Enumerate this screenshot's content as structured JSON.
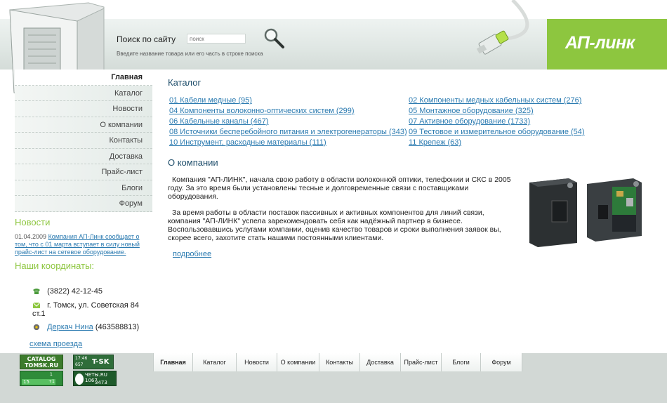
{
  "header": {
    "brand": "АП-линк",
    "search_title": "Поиск по сайту",
    "search_placeholder": "поиск",
    "search_hint": "Введите название товара или его часть в строке поиска"
  },
  "sidebar": {
    "items": [
      {
        "label": "Главная",
        "active": true
      },
      {
        "label": "Каталог"
      },
      {
        "label": "Новости"
      },
      {
        "label": "О компании"
      },
      {
        "label": "Контакты"
      },
      {
        "label": "Доставка"
      },
      {
        "label": "Прайс-лист"
      },
      {
        "label": "Блоги"
      },
      {
        "label": "Форум"
      }
    ],
    "news_title": "Новости",
    "news_date": "01.04.2009",
    "news_text": "Компания АП-Линк сообщает о том, что с 01 марта вступает в силу новый прайс-лист на сетевое оборудование.",
    "coords_title": "Наши координаты:",
    "phone": "(3822) 42-12-45",
    "address": "г. Томск, ул. Советская 84 ст.1",
    "icq_name": "Деркач Нина",
    "icq_number": "(463588813)",
    "scheme_link": "схема проезда"
  },
  "main": {
    "catalog_title": "Каталог",
    "catalog_left": [
      "01 Кабели медные (95)",
      "04 Компоненты волоконно-оптических систем (299)",
      "06 Кабельные каналы (467)",
      "08 Источники бесперебойного питания и электрогенераторы (343)",
      "10 Инструмент, расходные материалы (111)"
    ],
    "catalog_right": [
      "02 Компоненты медных кабельных систем (276)",
      "05 Монтажное оборудование (325)",
      "07 Активное оборудование (1733)",
      "09 Тестовое и измерительное оборудование (54)",
      "11 Крепеж (63)"
    ],
    "company_title": "О компании",
    "para1": "Компания \"АП-ЛИНК\", начала свою работу в области волоконной оптики, телефонии и СКС в 2005 году. За это время были установлены тесные и долговременные связи с поставщиками оборудования.",
    "para2": "За время работы в области поставок пассивных и активных компонентов для линий связи, компания \"АП-ЛИНК\" успела зарекомендовать себя как надёжный партнер в бизнесе. Воспользовавшись услугами компании, оценив качество товаров и сроки выполнения заявок вы, скорее всего, захотите стать нашими постоянными клиентами.",
    "more_link": "подробнее"
  },
  "footer": {
    "items": [
      "Главная",
      "Каталог",
      "Новости",
      "О компании",
      "Контакты",
      "Доставка",
      "Прайс-лист",
      "Блоги",
      "Форум"
    ],
    "badge_catalog_line1": "CATALOG",
    "badge_catalog_line2": "TOMSK.RU",
    "badge_counter_a": "15",
    "badge_counter_b": "+1",
    "badge_counter_c": "1",
    "badge_tsk_time": "17:46",
    "badge_tsk_num": "657",
    "badge_tsk_logo": "T-SK",
    "badge_rating_site": "ЧЕТЫ.RU 1067",
    "badge_rating_num": "3473"
  },
  "colors": {
    "accent_green": "#8dc63f",
    "link_blue": "#2a7ab0",
    "heading_navy": "#1f4e6b"
  },
  "icons": {
    "search": "magnifier-icon",
    "phone": "phone-icon",
    "mail": "envelope-icon",
    "icq": "icq-flower-icon"
  }
}
